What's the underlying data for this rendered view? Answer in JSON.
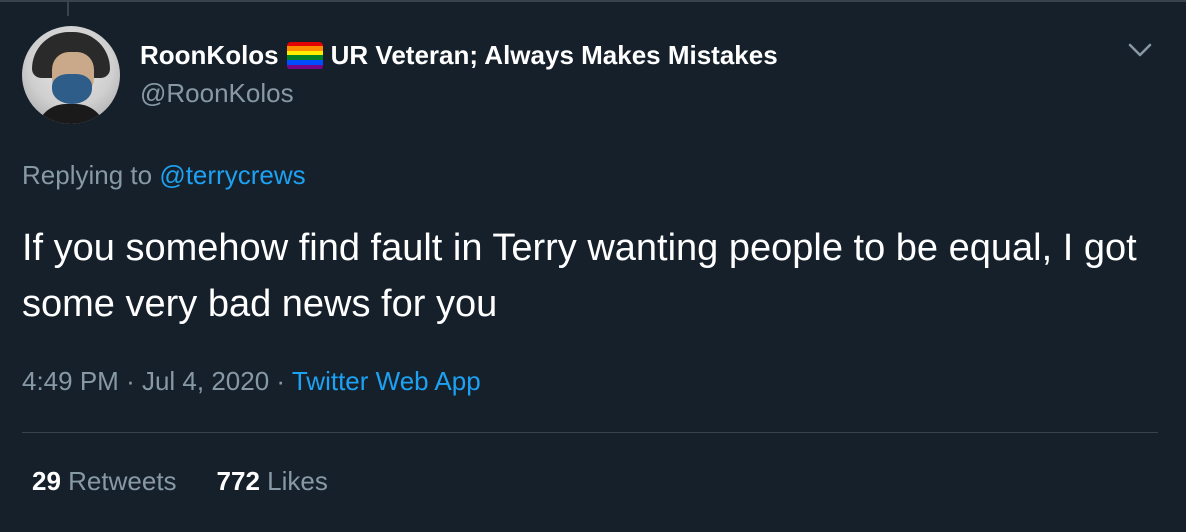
{
  "author": {
    "display_name": "RoonKolos",
    "display_suffix": "UR Veteran; Always Makes Mistakes",
    "handle": "@RoonKolos"
  },
  "reply": {
    "prefix": "Replying to",
    "mention": "@terrycrews"
  },
  "tweet": {
    "text": "If you somehow find fault in Terry wanting people to be equal, I got some very bad news for you"
  },
  "meta": {
    "time": "4:49 PM",
    "separator": "·",
    "date": "Jul 4, 2020",
    "source": "Twitter Web App"
  },
  "stats": {
    "retweets_count": "29",
    "retweets_label": "Retweets",
    "likes_count": "772",
    "likes_label": "Likes"
  },
  "icons": {
    "menu": "chevron-down-icon",
    "flag": "rainbow-flag-emoji"
  },
  "colors": {
    "background": "#15202b",
    "secondary_text": "#8899a6",
    "accent": "#1da1f2",
    "divider": "#38444d",
    "flag_stripes": [
      "#e40303",
      "#ff8c00",
      "#ffed00",
      "#008026",
      "#004dff",
      "#750787"
    ]
  }
}
